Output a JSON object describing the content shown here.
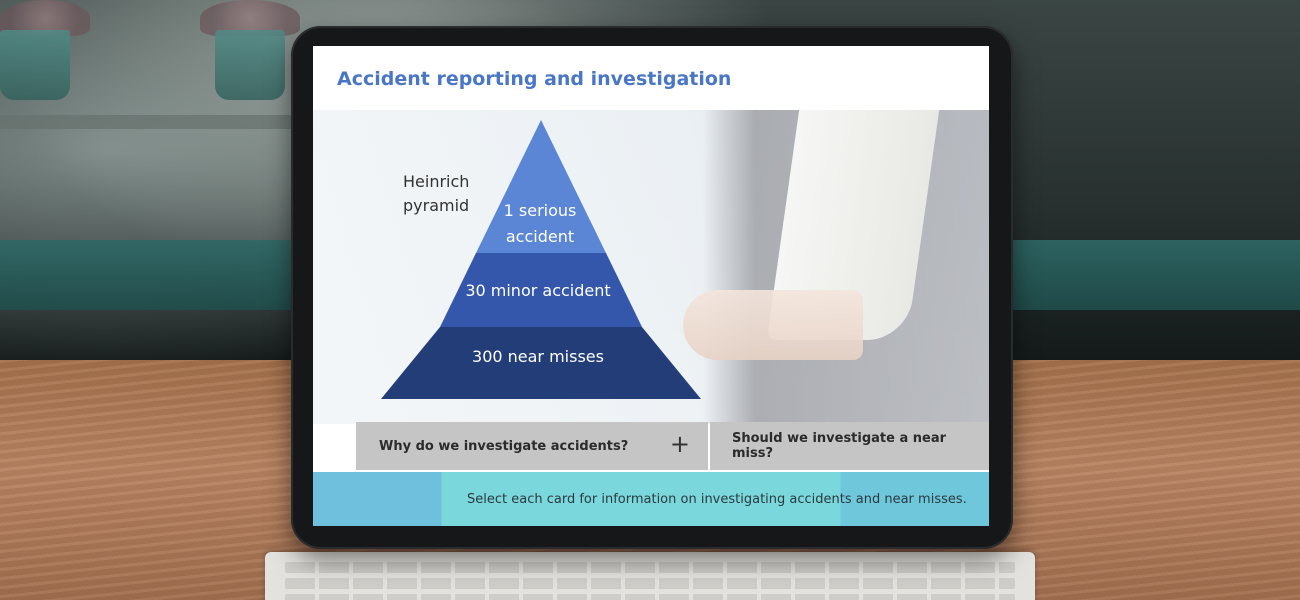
{
  "app": {
    "title": "Accident reporting and investigation"
  },
  "pyramid": {
    "label": "Heinrich\npyramid",
    "tiers": [
      {
        "text": "1 serious accident",
        "color": "#5b86d6"
      },
      {
        "text": "30 minor accident",
        "color": "#3457ab"
      },
      {
        "text": "300 near misses",
        "color": "#223d78"
      }
    ]
  },
  "cards": [
    {
      "label": "Why do we investigate accidents?",
      "icon": "plus-icon",
      "icon_glyph": "+"
    },
    {
      "label": "Should we investigate a near miss?"
    }
  ],
  "instruction": "Select each card for information on investigating accidents and near misses.",
  "colors": {
    "title": "#4a76c6",
    "card_bg": "#c5c5c5",
    "bar_teal": "#7ad8dc",
    "bar_blue": "#6fc0dc"
  }
}
